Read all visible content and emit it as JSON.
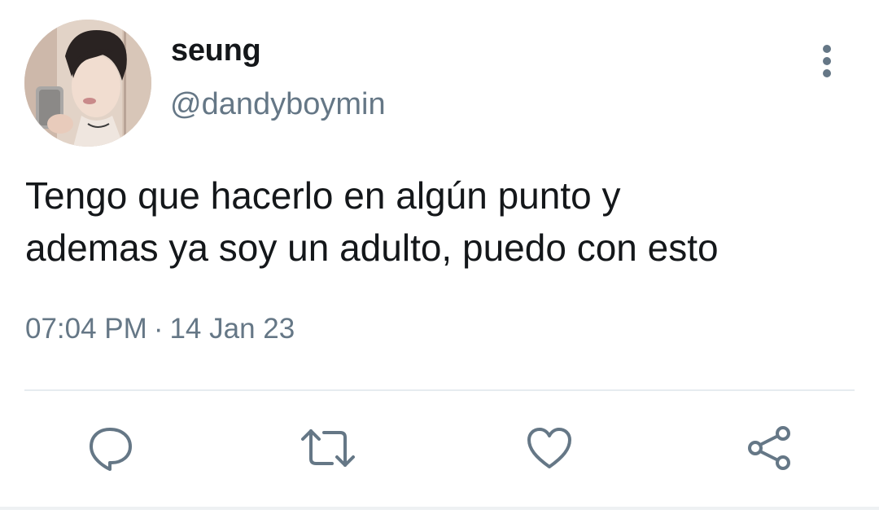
{
  "user": {
    "display_name": "seung",
    "handle": "@dandyboymin",
    "avatar_icon": "profile-photo"
  },
  "tweet": {
    "text": "Tengo que hacerlo en algún punto y\nademas ya soy un adulto, puedo con esto",
    "time": "07:04 PM",
    "separator": "·",
    "date": "14 Jan 23"
  },
  "actions": {
    "reply_icon": "reply-icon",
    "retweet_icon": "retweet-icon",
    "like_icon": "heart-icon",
    "share_icon": "share-icon",
    "more_icon": "more-vertical-icon"
  },
  "colors": {
    "text_primary": "#14171a",
    "text_secondary": "#657786",
    "divider": "#e6ecf0"
  }
}
